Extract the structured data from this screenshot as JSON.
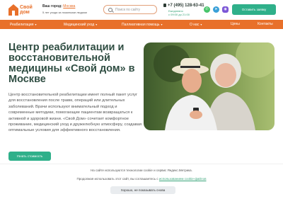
{
  "brand": {
    "line1": "Свой",
    "line2": "дом",
    "accent": "#e8702a"
  },
  "header": {
    "city_label": "Ваш город:",
    "city_value": "Москва",
    "tagline": "5 лет ухода за пожилыми людьми",
    "search_placeholder": "Поиск по сайту",
    "phone": "+7 (495) 128-63-41",
    "hours_line1": "Ежедневно",
    "hours_line2": "с 09:00 до 21:00",
    "social": [
      "whatsapp-icon",
      "telegram-icon",
      "max-icon"
    ],
    "cta": "Оставить заявку"
  },
  "nav": {
    "items": [
      {
        "label": "Реабилитация",
        "caret": "▾"
      },
      {
        "label": "Медицинский уход",
        "caret": "▾"
      },
      {
        "label": "Паллиативная помощь",
        "caret": "▾"
      },
      {
        "label": "О нас",
        "caret": "▾"
      },
      {
        "label": "Цены",
        "caret": ""
      },
      {
        "label": "Контакты",
        "caret": ""
      }
    ]
  },
  "hero": {
    "title": "Центр реабилитации и восстановительной медицины «Свой дом» в Москве",
    "description": "Центр восстановительной реабилитации имеет полный пакет услуг для восстановления после травм, операций или длительных заболеваний. Врачи используют внимательный подход и современные методики, помогающие пациентам возвращаться к активной и здоровой жизни. «Свой Дом» сочетает комфортное проживание, медицинский уход и дружелюбную атмосферу, создавая оптимальные условия для эффективного восстановления.",
    "cta": "Узнать стоимость"
  },
  "cookie": {
    "line1": "На сайте используются технологии cookie и сервис Яндекс.Метрика.",
    "line2_prefix": "Продолжая использовать этот сайт, вы соглашаетесь с",
    "line2_link": "использованием cookie-файлов",
    "button": "Хорошо, не показывать снова"
  },
  "colors": {
    "primary": "#2fb08a",
    "nav": "#e8702a",
    "heading": "#2f4d42"
  }
}
